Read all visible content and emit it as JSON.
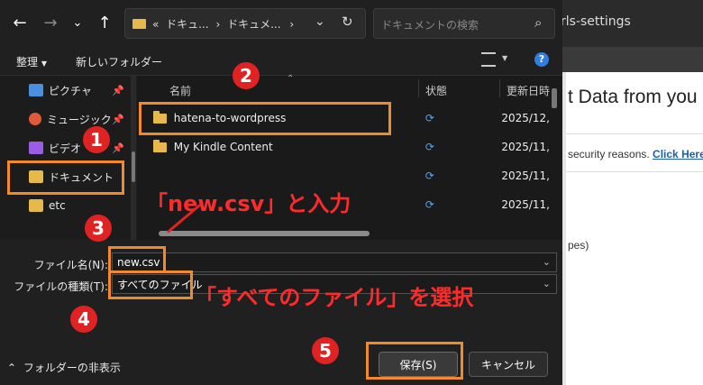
{
  "background_browser": {
    "tab_text": "rls-settings",
    "heading": "t Data from you",
    "notice_text": "security reasons.",
    "notice_link": "Click Here",
    "fragment": "pes)"
  },
  "dialog": {
    "breadcrumb": {
      "prefix": "«",
      "segments": [
        "ドキュ...",
        "ドキュメ..."
      ]
    },
    "search_placeholder": "ドキュメントの検索",
    "commands": {
      "organize": "整理",
      "new_folder": "新しいフォルダー"
    },
    "nav_items": [
      {
        "label": "ピクチャ",
        "icon": "pictures-icon",
        "color": "#4a8fe0"
      },
      {
        "label": "ミュージック",
        "icon": "music-icon",
        "color": "#e05a3a"
      },
      {
        "label": "ビデオ",
        "icon": "video-icon",
        "color": "#9b5de5"
      },
      {
        "label": "ドキュメント",
        "icon": "documents-folder-icon",
        "color": "#e7b84a"
      },
      {
        "label": "etc",
        "icon": "folder-icon",
        "color": "#e7b84a"
      }
    ],
    "columns": {
      "name": "名前",
      "status": "状態",
      "date": "更新日時"
    },
    "files": [
      {
        "name": "hatena-to-wordpress",
        "date": "2025/12,"
      },
      {
        "name": "My Kindle Content",
        "date": "2025/11,"
      },
      {
        "name": "",
        "date": "2025/11,"
      },
      {
        "name": "",
        "date": "2025/11,"
      }
    ],
    "filename_label": "ファイル名(N):",
    "filename_value": "new.csv",
    "filetype_label": "ファイルの種類(T):",
    "filetype_value": "すべてのファイル",
    "hide_folders": "フォルダーの非表示",
    "save_button": "保存(S)",
    "cancel_button": "キャンセル"
  },
  "annotations": {
    "numbers": [
      "1",
      "2",
      "3",
      "4",
      "5"
    ],
    "text_input": "「new.csv」と入力",
    "text_select": "「すべてのファイル」を選択",
    "color": "#f08a2a",
    "red": "#e02222"
  }
}
